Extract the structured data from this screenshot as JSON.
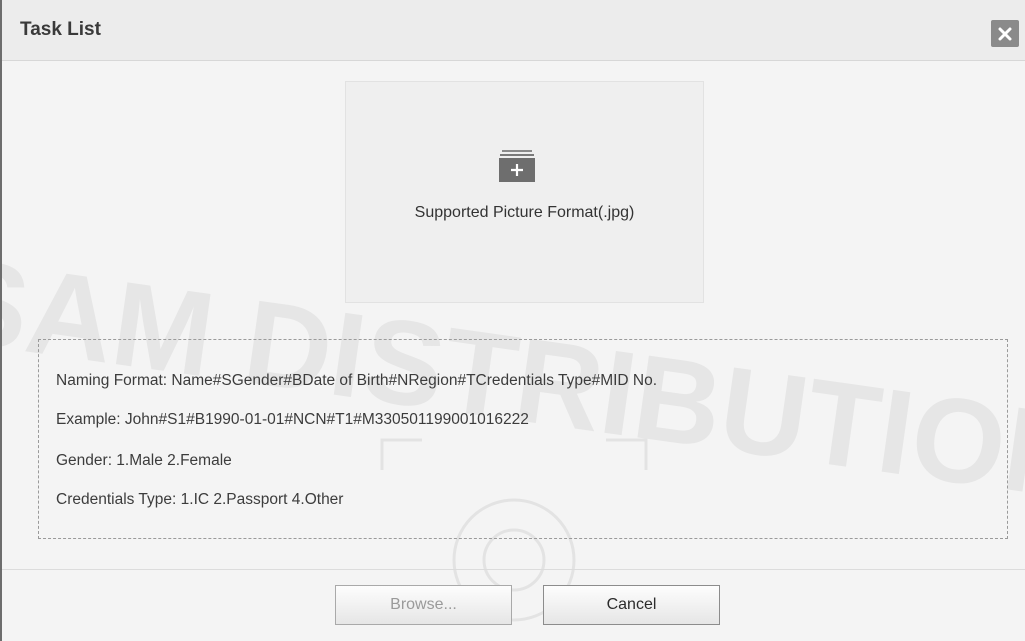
{
  "dialog": {
    "title": "Task List"
  },
  "upload": {
    "label": "Supported Picture Format(.jpg)",
    "icon": "folder-add-icon"
  },
  "info": {
    "naming_format": "Naming Format:  Name#SGender#BDate of Birth#NRegion#TCredentials Type#MID No.",
    "example": "Example:  John#S1#B1990-01-01#NCN#T1#M330501199001016222",
    "gender": "Gender:  1.Male 2.Female",
    "credentials_type": "Credentials Type:  1.IC 2.Passport 4.Other"
  },
  "buttons": {
    "browse": "Browse...",
    "cancel": "Cancel"
  },
  "colors": {
    "close_button_bg": "#8a8a8a",
    "icon_gray": "#6e6e6e"
  }
}
